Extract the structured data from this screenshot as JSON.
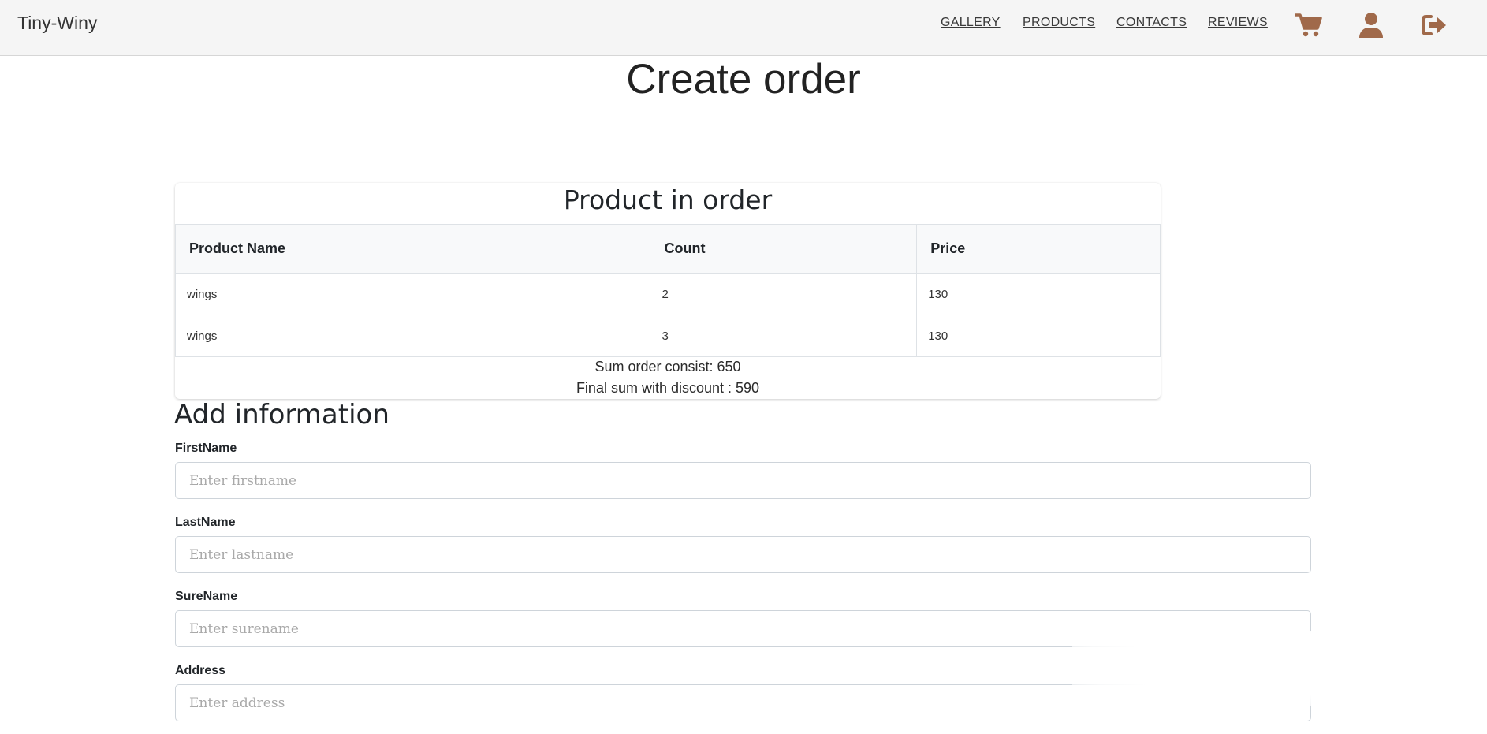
{
  "header": {
    "brand": "Tiny-Winy",
    "nav": {
      "gallery": "GALLERY",
      "products": "PRODUCTS",
      "contacts": "CONTACTS",
      "reviews": "REVIEWS"
    },
    "icons": [
      "cart-icon",
      "user-icon",
      "logout-icon"
    ],
    "icon_color": "#a0694a"
  },
  "page": {
    "title": "Create order"
  },
  "order": {
    "title": "Product in order",
    "columns": [
      "Product Name",
      "Count",
      "Price"
    ],
    "rows": [
      [
        "wings",
        "2",
        "130"
      ],
      [
        "wings",
        "3",
        "130"
      ]
    ],
    "sum_text": "Sum order consist: 650",
    "final_text": "Final sum with discount : 590"
  },
  "form": {
    "title": "Add information",
    "firstname": {
      "label": "FirstName",
      "placeholder": "Enter firstname"
    },
    "lastname": {
      "label": "LastName",
      "placeholder": "Enter lastname"
    },
    "surename": {
      "label": "SureName",
      "placeholder": "Enter surename"
    },
    "address": {
      "label": "Address",
      "placeholder": "Enter address"
    }
  }
}
